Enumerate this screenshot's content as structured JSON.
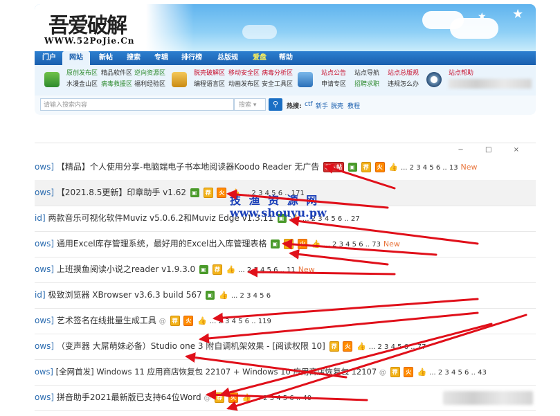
{
  "site": {
    "logo_text": "吾爱破解",
    "logo_url": "WWW.52PoJie.Cn"
  },
  "nav": {
    "items": [
      "门户",
      "网站",
      "新帖",
      "搜索",
      "专辑",
      "排行榜",
      "总版规",
      "爱盘",
      "帮助"
    ],
    "active_index": 1,
    "hot_index": 7
  },
  "subnav": {
    "col1": [
      "原创发布区",
      "精品软件区",
      "逆向资源区",
      "水漫金山区",
      "病毒救援区",
      "福利经验区"
    ],
    "col2": [
      "脱壳破解区",
      "移动安全区",
      "病毒分析区",
      "编程语言区",
      "动画发布区",
      "安全工具区"
    ],
    "col3": [
      "站点公告",
      "站点导航",
      "站点总版规",
      "申请专区",
      "招聘求职",
      "违规怎么办"
    ],
    "col4": [
      "站点帮助"
    ]
  },
  "search": {
    "placeholder": "请输入搜索内容",
    "scope": "搜索 ▾",
    "hot_label": "热搜:",
    "hot_links": [
      "ctf",
      "新手",
      "脱壳",
      "教程"
    ]
  },
  "window_controls": "− □ ×",
  "threads": [
    {
      "prefix": "ows]",
      "title": "【精品】个人使用分享-电脑端电子书本地阅读器Koodo Reader 无广告",
      "pages": "... 2 3 4 5 6 .. 13",
      "new": "New"
    },
    {
      "prefix": "ows]",
      "title": "【2021.8.5更新】印章助手 v1.62",
      "pages": "... 2 3 4 5 6 .. 171",
      "new": ""
    },
    {
      "prefix": "id]",
      "title": "两款音乐可视化软件Muviz v5.0.6.2和Muviz Edge v1.3.11",
      "pages": "... 2 3 4 5 6 .. 27",
      "new": ""
    },
    {
      "prefix": "ows]",
      "title": "通用Excel库存管理系统，最好用的Excel出入库管理表格",
      "pages": "... 2 3 4 5 6 .. 73",
      "new": "New"
    },
    {
      "prefix": "ows]",
      "title": "上班摸鱼阅读小说之reader v1.9.3.0",
      "pages": "... 2 3 4 5 6 .. 11",
      "new": "New"
    },
    {
      "prefix": "id]",
      "title": "极致浏览器 XBrowser v3.6.3 build 567",
      "pages": "... 2 3 4 5 6",
      "new": ""
    },
    {
      "prefix": "ows]",
      "title": "艺术签名在线批量生成工具",
      "pages": "... 2 3 4 5 6 .. 119",
      "new": ""
    },
    {
      "prefix": "ows]",
      "title": "（变声器 大屌萌妹必备）Studio one 3 附自调机架效果 - [阅读权限 10]",
      "pages": "... 2 3 4 5 6 .. 77",
      "new": ""
    },
    {
      "prefix": "ows]",
      "title": "[全网首发] Windows 11 应用商店恢复包 22107 + Windows 10 应用商店恢复包 12107",
      "pages": "... 2 3 4 5 6 .. 43",
      "new": ""
    },
    {
      "prefix": "ows]",
      "title": "拼音助手2021最新版已支持64位Word",
      "pages": "... 2 3 4 5 6 .. 40",
      "new": ""
    }
  ],
  "badges": {
    "img": "▣",
    "jian": "荐",
    "huo": "火",
    "xin": "新人帖",
    "thumb": "👍",
    "clip": "@"
  },
  "watermark": {
    "cn": "技 渔 资 源 网",
    "url": "www.shouyu.pw"
  },
  "colors": {
    "nav_blue": "#1a5fae",
    "annotation_red": "#e0101a",
    "watermark_blue": "#1a3fb8",
    "new_orange": "#e8743b"
  }
}
